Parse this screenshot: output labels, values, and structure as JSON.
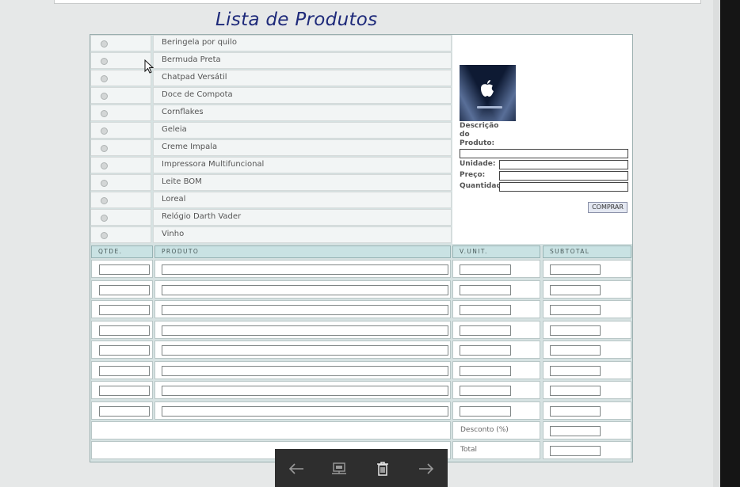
{
  "page": {
    "title": "Lista de Produtos"
  },
  "products": [
    "Beringela por quilo",
    "Bermuda Preta",
    "Chatpad Versátil",
    "Doce de Compota",
    "Cornflakes",
    "Geleia",
    "Creme Impala",
    "Impressora Multifuncional",
    "Leite BOM",
    "Loreal",
    "Relógio Darth Vader",
    "Vinho"
  ],
  "detail": {
    "desc_label": "Descrição do Produto:",
    "desc_value": "",
    "unit_label": "Unidade:",
    "unit_value": "",
    "price_label": "Preço:",
    "price_value": "",
    "qty_label": "Quantidade",
    "qty_value": "",
    "buy_button": "COMPRAR",
    "image_icon": "apple-logo-icon"
  },
  "order_table": {
    "headers": [
      "QTDE.",
      "PRODUTO",
      "V.UNIT.",
      "SUBTOTAL"
    ],
    "row_count": 8,
    "discount_label": "Desconto (%)",
    "discount_value": "",
    "total_label": "Total",
    "total_value": ""
  },
  "viewer_toolbar": {
    "buttons": [
      "arrow-left-icon",
      "slideshow-icon",
      "trash-icon",
      "arrow-right-icon"
    ]
  },
  "colors": {
    "title": "#1e2a7a",
    "header_bg": "#c9e2e3",
    "panel_bg": "#d6e2e2"
  }
}
